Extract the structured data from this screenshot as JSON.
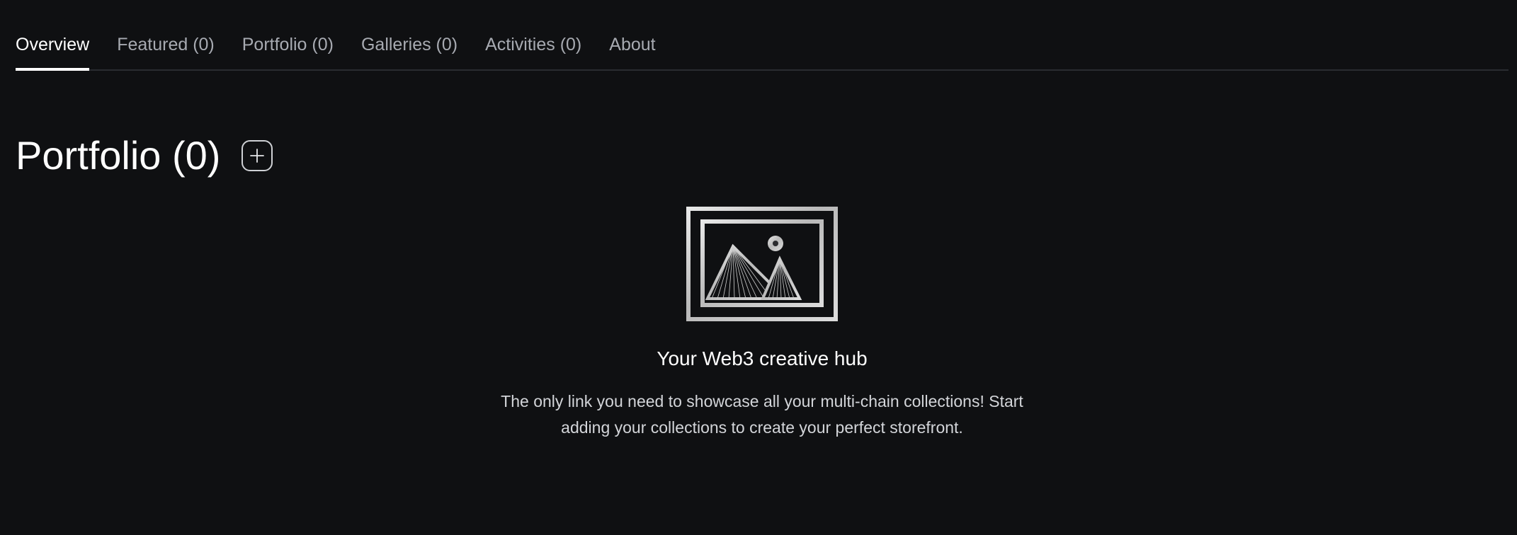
{
  "tabs": [
    {
      "label": "Overview",
      "active": true
    },
    {
      "label": "Featured (0)",
      "active": false
    },
    {
      "label": "Portfolio (0)",
      "active": false
    },
    {
      "label": "Galleries (0)",
      "active": false
    },
    {
      "label": "Activities (0)",
      "active": false
    },
    {
      "label": "About",
      "active": false
    }
  ],
  "section": {
    "title": "Portfolio (0)",
    "add_icon": "plus-icon"
  },
  "empty_state": {
    "illustration_icon": "image-placeholder-icon",
    "heading": "Your Web3 creative hub",
    "description": "The only link you need to showcase all your multi-chain collections! Start adding your collections to create your perfect storefront."
  },
  "colors": {
    "background": "#0f1012",
    "text_primary": "#ffffff",
    "text_muted": "#a7aab1",
    "divider": "#2a2c30"
  }
}
